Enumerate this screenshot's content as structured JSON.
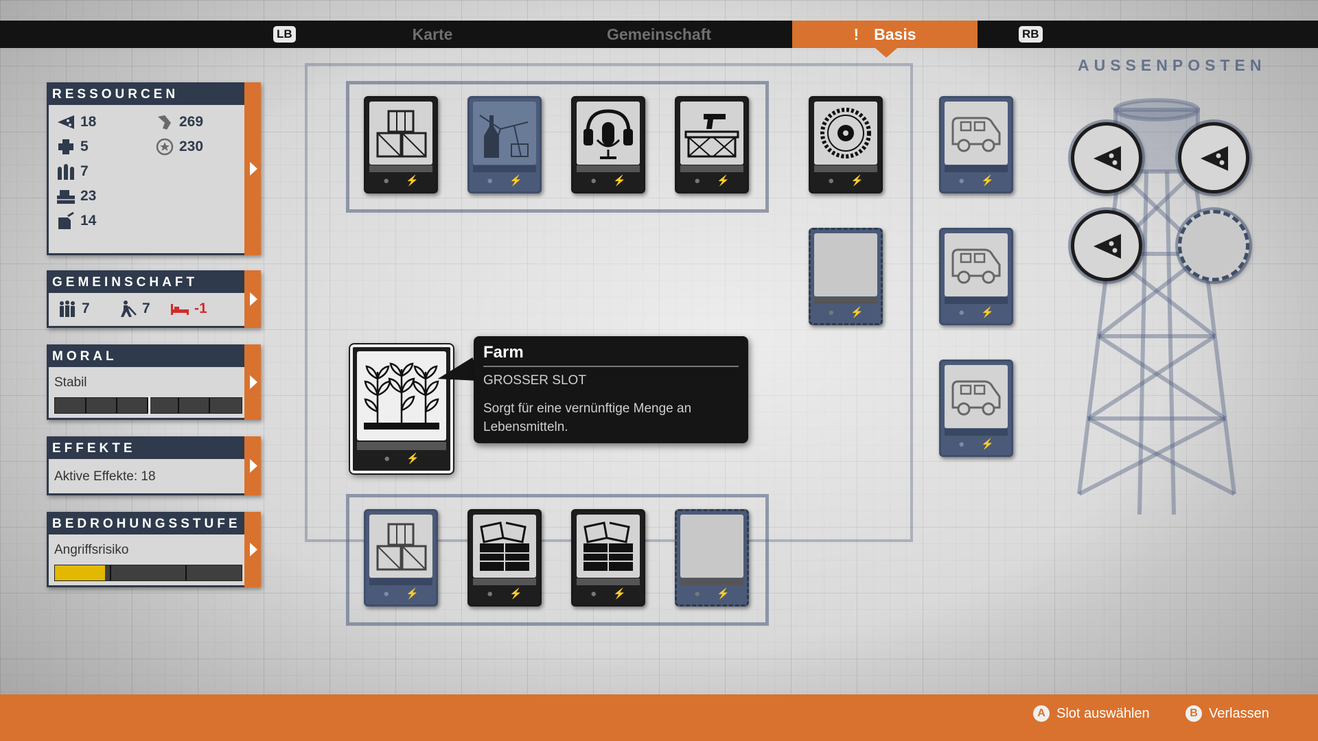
{
  "nav": {
    "lb": "LB",
    "rb": "RB",
    "tabs": [
      {
        "label": "Karte"
      },
      {
        "label": "Gemeinschaft"
      },
      {
        "label": "Basis",
        "alert": "!"
      }
    ]
  },
  "panels": {
    "resources": {
      "title": "RESSOURCEN",
      "items": [
        {
          "icon": "food-icon",
          "value": "18"
        },
        {
          "icon": "medicine-icon",
          "value": "5"
        },
        {
          "icon": "ammo-icon",
          "value": "7"
        },
        {
          "icon": "materials-icon",
          "value": "23"
        },
        {
          "icon": "fuel-icon",
          "value": "14"
        },
        {
          "icon": "influence-icon",
          "value": "269"
        },
        {
          "icon": "prestige-icon",
          "value": "230"
        }
      ]
    },
    "community": {
      "title": "GEMEINSCHAFT",
      "survivors": "7",
      "workers": "7",
      "beds": "-1"
    },
    "morale": {
      "title": "MORAL",
      "status": "Stabil",
      "level": 0.5
    },
    "effects": {
      "title": "EFFEKTE",
      "text": "Aktive Effekte: 18"
    },
    "threat": {
      "title": "BEDROHUNGSSTUFE",
      "label": "Angriffsrisiko",
      "level": 0.27
    }
  },
  "tooltip": {
    "title": "Farm",
    "subtitle": "GROSSER SLOT",
    "description": "Sorgt für eine vernünftige Menge an Lebensmitteln."
  },
  "outposts": {
    "title": "AUSSENPOSTEN"
  },
  "footer": {
    "select_button": "A",
    "select_label": "Slot auswählen",
    "leave_button": "B",
    "leave_label": "Verlassen"
  },
  "colors": {
    "accent": "#d9722e",
    "panel": "#2f3a4c",
    "alert": "#d42a2a",
    "threat": "#e3b800"
  }
}
